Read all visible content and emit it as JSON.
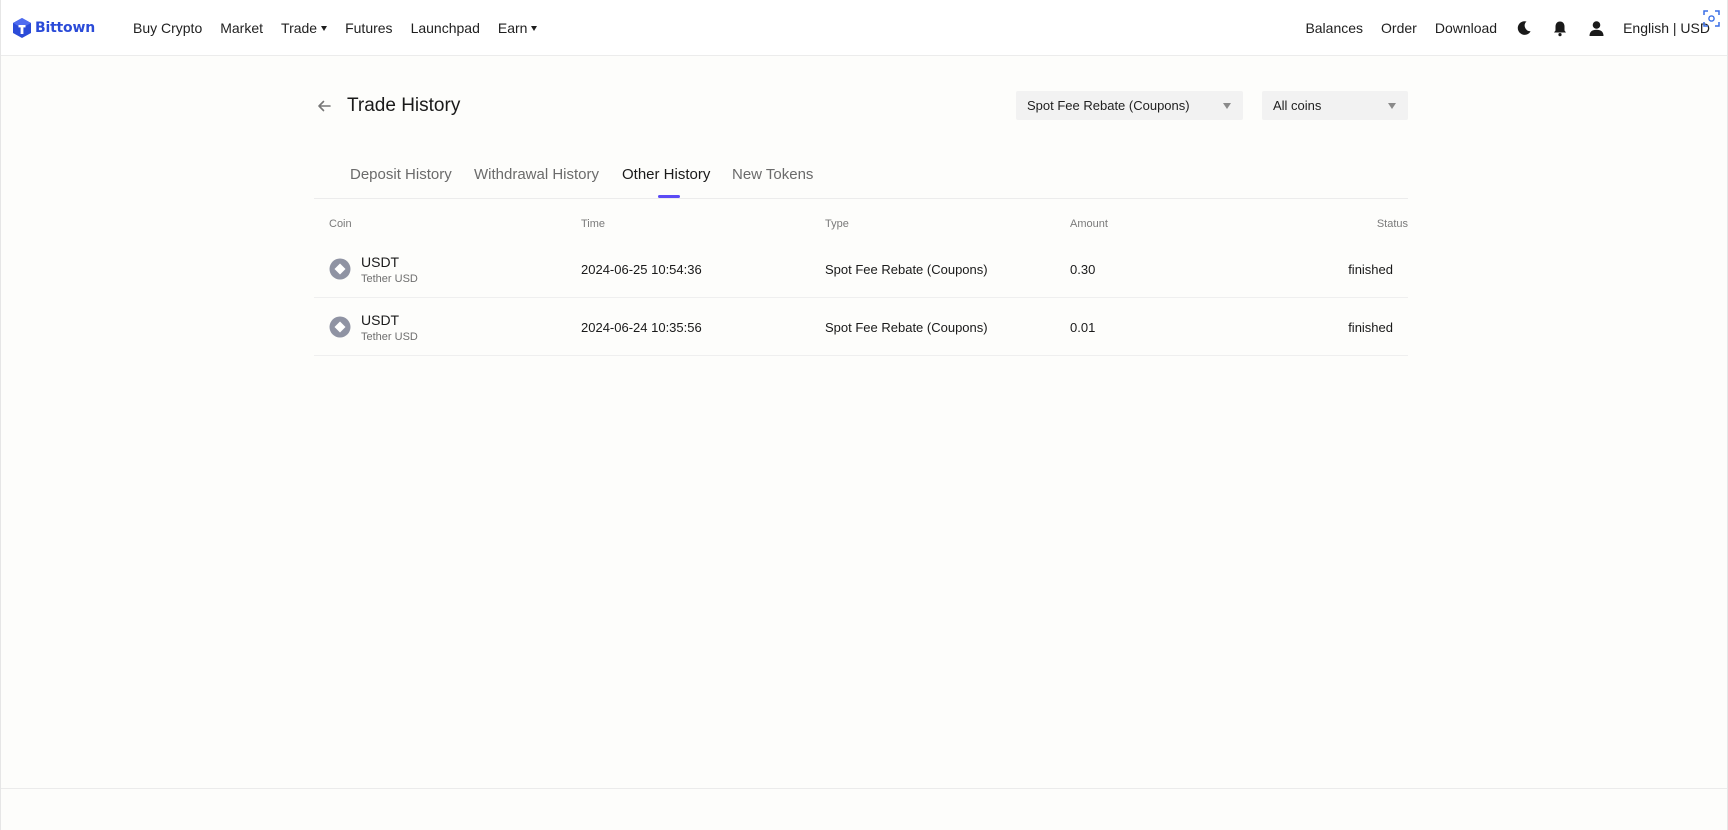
{
  "nav": {
    "logo_text": "Bittown",
    "left_items": [
      {
        "label": "Buy Crypto",
        "has_caret": false
      },
      {
        "label": "Market",
        "has_caret": false
      },
      {
        "label": "Trade",
        "has_caret": true
      },
      {
        "label": "Futures",
        "has_caret": false
      },
      {
        "label": "Launchpad",
        "has_caret": false
      },
      {
        "label": "Earn",
        "has_caret": true
      }
    ],
    "right_items": {
      "balances": "Balances",
      "order": "Order",
      "download": "Download",
      "language": "English | USD"
    },
    "icons": [
      "moon-icon",
      "bell-icon",
      "user-icon",
      "scan-icon"
    ],
    "brand_color": "#2b4bd8"
  },
  "header": {
    "title": "Trade History",
    "type_filter": "Spot Fee Rebate (Coupons)",
    "coin_filter": "All coins"
  },
  "tabs": [
    {
      "label": "Deposit History",
      "active": false
    },
    {
      "label": "Withdrawal History",
      "active": false
    },
    {
      "label": "Other History",
      "active": true
    },
    {
      "label": "New Tokens",
      "active": false
    }
  ],
  "accent_color": "#5b4bf5",
  "table": {
    "columns": {
      "coin": "Coin",
      "time": "Time",
      "type": "Type",
      "amount": "Amount",
      "status": "Status"
    },
    "rows": [
      {
        "symbol": "USDT",
        "name": "Tether USD",
        "time": "2024-06-25 10:54:36",
        "type": "Spot Fee Rebate (Coupons)",
        "amount": "0.30",
        "status": "finished"
      },
      {
        "symbol": "USDT",
        "name": "Tether USD",
        "time": "2024-06-24 10:35:56",
        "type": "Spot Fee Rebate (Coupons)",
        "amount": "0.01",
        "status": "finished"
      }
    ]
  }
}
